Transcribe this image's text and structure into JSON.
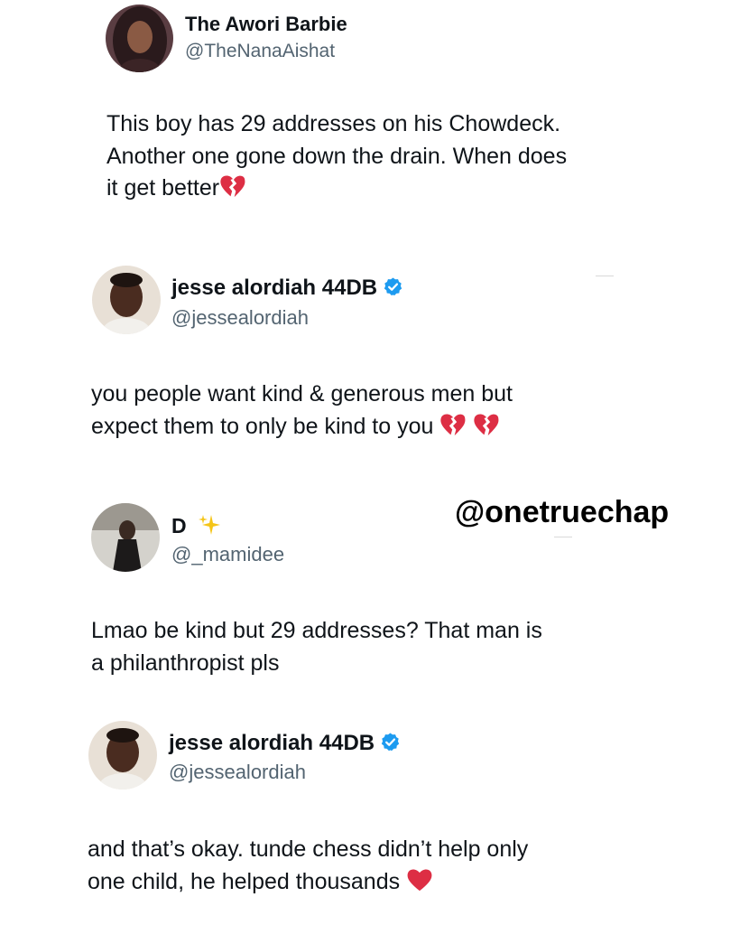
{
  "posts": [
    {
      "display_name": "The Awori Barbie",
      "handle": "@TheNanaAishat",
      "verified": false,
      "lines": [
        "This boy has 29 addresses on his Chowdeck.",
        "Another one gone down the drain. When does",
        "it get better"
      ],
      "trailing_emoji": [
        "broken-heart-icon"
      ]
    },
    {
      "display_name": "jesse alordiah 44DB",
      "handle": "@jessealordiah",
      "verified": true,
      "lines": [
        "you people want kind & generous men but",
        "expect them to only be kind to you"
      ],
      "trailing_emoji": [
        "broken-heart-icon",
        "broken-heart-icon"
      ]
    },
    {
      "display_name": "D",
      "handle": "@_mamidee",
      "verified": false,
      "name_emoji": "sparkles-icon",
      "lines": [
        "Lmao be kind but 29 addresses? That man is",
        "a philanthropist pls"
      ]
    },
    {
      "display_name": "jesse alordiah 44DB",
      "handle": "@jessealordiah",
      "verified": true,
      "lines": [
        "and that’s okay. tunde chess didn’t help only",
        "one child, he helped thousands"
      ],
      "trailing_emoji": [
        "red-heart-icon"
      ]
    }
  ],
  "watermark": "@onetruechap",
  "colors": {
    "text": "#0f1419",
    "handle": "#536471",
    "verified_badge": "#1d9bf0",
    "heart": "#e0245e"
  }
}
